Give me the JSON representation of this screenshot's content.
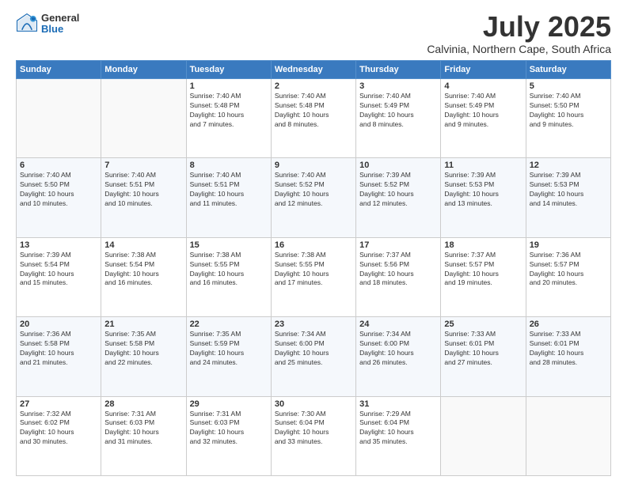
{
  "header": {
    "logo_general": "General",
    "logo_blue": "Blue",
    "title": "July 2025",
    "location": "Calvinia, Northern Cape, South Africa"
  },
  "days_of_week": [
    "Sunday",
    "Monday",
    "Tuesday",
    "Wednesday",
    "Thursday",
    "Friday",
    "Saturday"
  ],
  "weeks": [
    [
      {
        "day": "",
        "info": ""
      },
      {
        "day": "",
        "info": ""
      },
      {
        "day": "1",
        "info": "Sunrise: 7:40 AM\nSunset: 5:48 PM\nDaylight: 10 hours\nand 7 minutes."
      },
      {
        "day": "2",
        "info": "Sunrise: 7:40 AM\nSunset: 5:48 PM\nDaylight: 10 hours\nand 8 minutes."
      },
      {
        "day": "3",
        "info": "Sunrise: 7:40 AM\nSunset: 5:49 PM\nDaylight: 10 hours\nand 8 minutes."
      },
      {
        "day": "4",
        "info": "Sunrise: 7:40 AM\nSunset: 5:49 PM\nDaylight: 10 hours\nand 9 minutes."
      },
      {
        "day": "5",
        "info": "Sunrise: 7:40 AM\nSunset: 5:50 PM\nDaylight: 10 hours\nand 9 minutes."
      }
    ],
    [
      {
        "day": "6",
        "info": "Sunrise: 7:40 AM\nSunset: 5:50 PM\nDaylight: 10 hours\nand 10 minutes."
      },
      {
        "day": "7",
        "info": "Sunrise: 7:40 AM\nSunset: 5:51 PM\nDaylight: 10 hours\nand 10 minutes."
      },
      {
        "day": "8",
        "info": "Sunrise: 7:40 AM\nSunset: 5:51 PM\nDaylight: 10 hours\nand 11 minutes."
      },
      {
        "day": "9",
        "info": "Sunrise: 7:40 AM\nSunset: 5:52 PM\nDaylight: 10 hours\nand 12 minutes."
      },
      {
        "day": "10",
        "info": "Sunrise: 7:39 AM\nSunset: 5:52 PM\nDaylight: 10 hours\nand 12 minutes."
      },
      {
        "day": "11",
        "info": "Sunrise: 7:39 AM\nSunset: 5:53 PM\nDaylight: 10 hours\nand 13 minutes."
      },
      {
        "day": "12",
        "info": "Sunrise: 7:39 AM\nSunset: 5:53 PM\nDaylight: 10 hours\nand 14 minutes."
      }
    ],
    [
      {
        "day": "13",
        "info": "Sunrise: 7:39 AM\nSunset: 5:54 PM\nDaylight: 10 hours\nand 15 minutes."
      },
      {
        "day": "14",
        "info": "Sunrise: 7:38 AM\nSunset: 5:54 PM\nDaylight: 10 hours\nand 16 minutes."
      },
      {
        "day": "15",
        "info": "Sunrise: 7:38 AM\nSunset: 5:55 PM\nDaylight: 10 hours\nand 16 minutes."
      },
      {
        "day": "16",
        "info": "Sunrise: 7:38 AM\nSunset: 5:55 PM\nDaylight: 10 hours\nand 17 minutes."
      },
      {
        "day": "17",
        "info": "Sunrise: 7:37 AM\nSunset: 5:56 PM\nDaylight: 10 hours\nand 18 minutes."
      },
      {
        "day": "18",
        "info": "Sunrise: 7:37 AM\nSunset: 5:57 PM\nDaylight: 10 hours\nand 19 minutes."
      },
      {
        "day": "19",
        "info": "Sunrise: 7:36 AM\nSunset: 5:57 PM\nDaylight: 10 hours\nand 20 minutes."
      }
    ],
    [
      {
        "day": "20",
        "info": "Sunrise: 7:36 AM\nSunset: 5:58 PM\nDaylight: 10 hours\nand 21 minutes."
      },
      {
        "day": "21",
        "info": "Sunrise: 7:35 AM\nSunset: 5:58 PM\nDaylight: 10 hours\nand 22 minutes."
      },
      {
        "day": "22",
        "info": "Sunrise: 7:35 AM\nSunset: 5:59 PM\nDaylight: 10 hours\nand 24 minutes."
      },
      {
        "day": "23",
        "info": "Sunrise: 7:34 AM\nSunset: 6:00 PM\nDaylight: 10 hours\nand 25 minutes."
      },
      {
        "day": "24",
        "info": "Sunrise: 7:34 AM\nSunset: 6:00 PM\nDaylight: 10 hours\nand 26 minutes."
      },
      {
        "day": "25",
        "info": "Sunrise: 7:33 AM\nSunset: 6:01 PM\nDaylight: 10 hours\nand 27 minutes."
      },
      {
        "day": "26",
        "info": "Sunrise: 7:33 AM\nSunset: 6:01 PM\nDaylight: 10 hours\nand 28 minutes."
      }
    ],
    [
      {
        "day": "27",
        "info": "Sunrise: 7:32 AM\nSunset: 6:02 PM\nDaylight: 10 hours\nand 30 minutes."
      },
      {
        "day": "28",
        "info": "Sunrise: 7:31 AM\nSunset: 6:03 PM\nDaylight: 10 hours\nand 31 minutes."
      },
      {
        "day": "29",
        "info": "Sunrise: 7:31 AM\nSunset: 6:03 PM\nDaylight: 10 hours\nand 32 minutes."
      },
      {
        "day": "30",
        "info": "Sunrise: 7:30 AM\nSunset: 6:04 PM\nDaylight: 10 hours\nand 33 minutes."
      },
      {
        "day": "31",
        "info": "Sunrise: 7:29 AM\nSunset: 6:04 PM\nDaylight: 10 hours\nand 35 minutes."
      },
      {
        "day": "",
        "info": ""
      },
      {
        "day": "",
        "info": ""
      }
    ]
  ]
}
